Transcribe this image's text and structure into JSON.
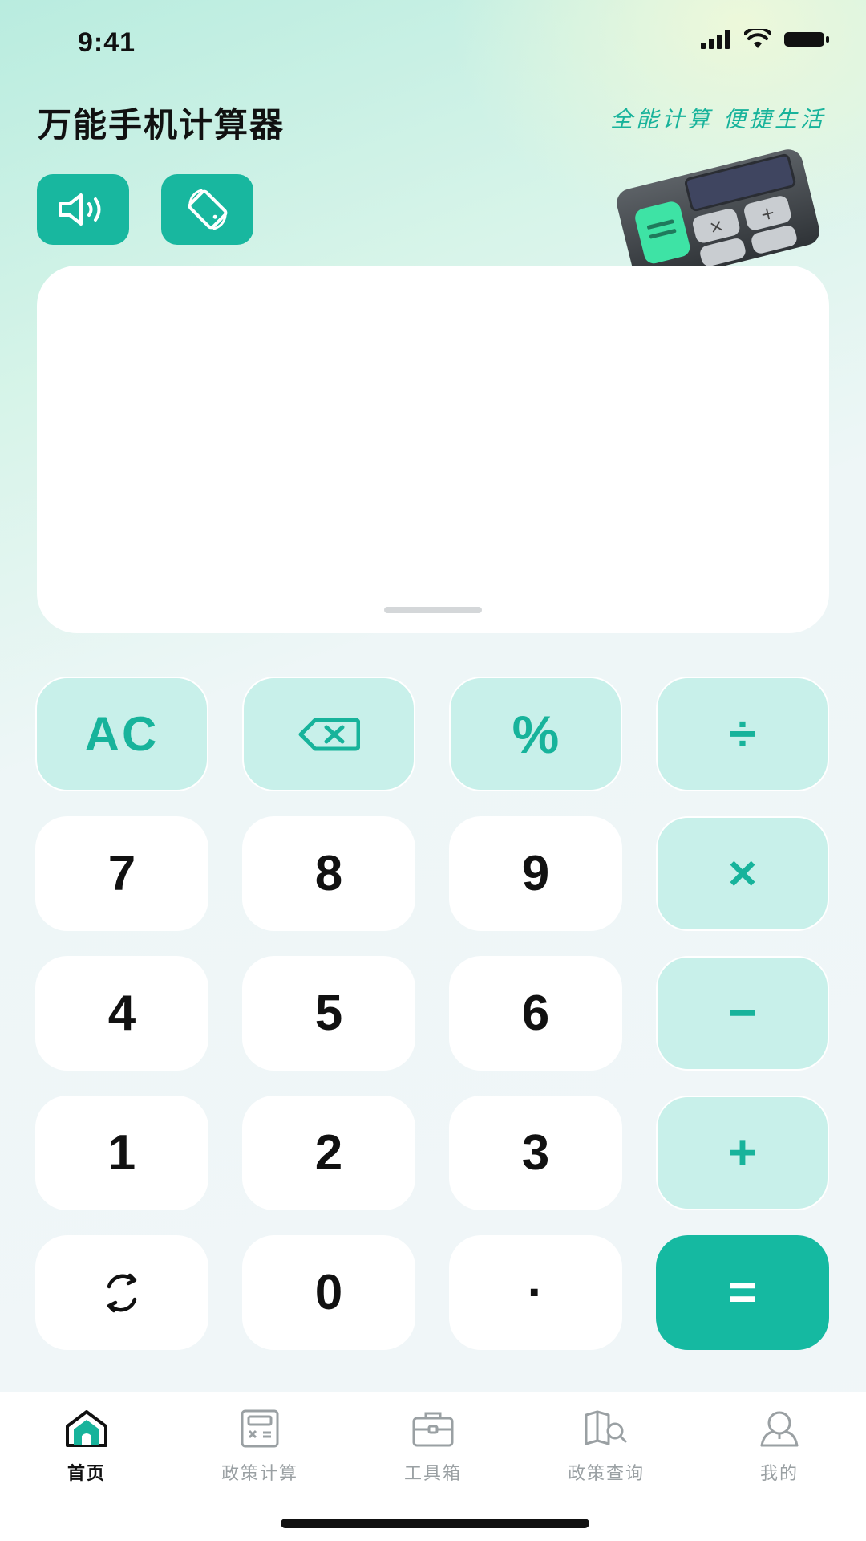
{
  "status_bar": {
    "time": "9:41"
  },
  "header": {
    "title": "万能手机计算器",
    "slogan": "全能计算 便捷生活"
  },
  "toolbar": {
    "sound_icon": "speaker-icon",
    "rotate_icon": "rotate-screen-icon"
  },
  "display": {
    "value": ""
  },
  "keypad": {
    "rows": [
      [
        {
          "label": "AC",
          "kind": "func"
        },
        {
          "label": "⌫",
          "kind": "func",
          "icon": "backspace-icon"
        },
        {
          "label": "%",
          "kind": "func"
        },
        {
          "label": "÷",
          "kind": "op"
        }
      ],
      [
        {
          "label": "7",
          "kind": "num"
        },
        {
          "label": "8",
          "kind": "num"
        },
        {
          "label": "9",
          "kind": "num"
        },
        {
          "label": "×",
          "kind": "op"
        }
      ],
      [
        {
          "label": "4",
          "kind": "num"
        },
        {
          "label": "5",
          "kind": "num"
        },
        {
          "label": "6",
          "kind": "num"
        },
        {
          "label": "−",
          "kind": "op"
        }
      ],
      [
        {
          "label": "1",
          "kind": "num"
        },
        {
          "label": "2",
          "kind": "num"
        },
        {
          "label": "3",
          "kind": "num"
        },
        {
          "label": "+",
          "kind": "op"
        }
      ],
      [
        {
          "label": "⟳",
          "kind": "num",
          "icon": "refresh-icon"
        },
        {
          "label": "0",
          "kind": "num"
        },
        {
          "label": "·",
          "kind": "num"
        },
        {
          "label": "=",
          "kind": "eq"
        }
      ]
    ]
  },
  "nav": {
    "items": [
      {
        "label": "首页",
        "icon": "home-icon",
        "active": true
      },
      {
        "label": "政策计算",
        "icon": "policy-calc-icon",
        "active": false
      },
      {
        "label": "工具箱",
        "icon": "toolbox-icon",
        "active": false
      },
      {
        "label": "政策查询",
        "icon": "policy-search-icon",
        "active": false
      },
      {
        "label": "我的",
        "icon": "profile-icon",
        "active": false
      }
    ]
  },
  "colors": {
    "accent": "#18b79f",
    "key_tint": "#c8f0ea"
  }
}
